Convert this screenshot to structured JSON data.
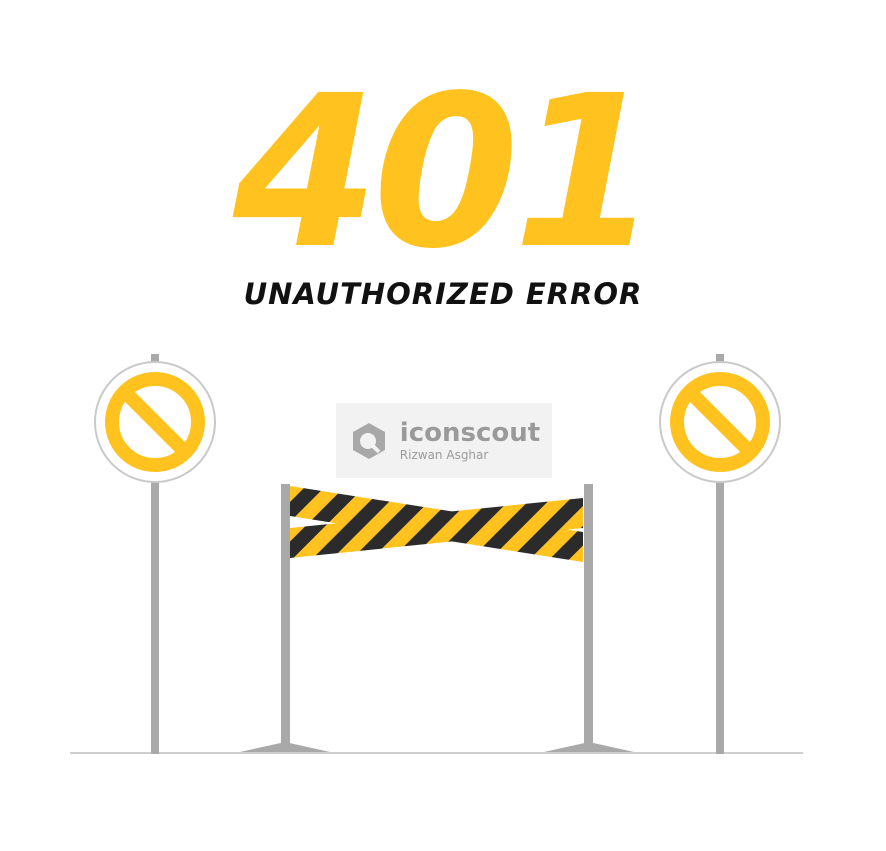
{
  "error": {
    "code": "401",
    "message": "UNAUTHORIZED ERROR"
  },
  "watermark": {
    "brand": "iconscout",
    "author": "Rizwan Asghar"
  },
  "colors": {
    "accent": "#ffc21f",
    "text": "#111111",
    "pole": "#a9a9a9",
    "tape_dark": "#2b2b2b",
    "watermark_bg": "#f2f2f2"
  },
  "icons": {
    "left_sign": "no-entry-sign-icon",
    "right_sign": "no-entry-sign-icon",
    "barrier": "caution-tape-barrier-icon",
    "watermark_logo": "iconscout-logo-icon"
  }
}
